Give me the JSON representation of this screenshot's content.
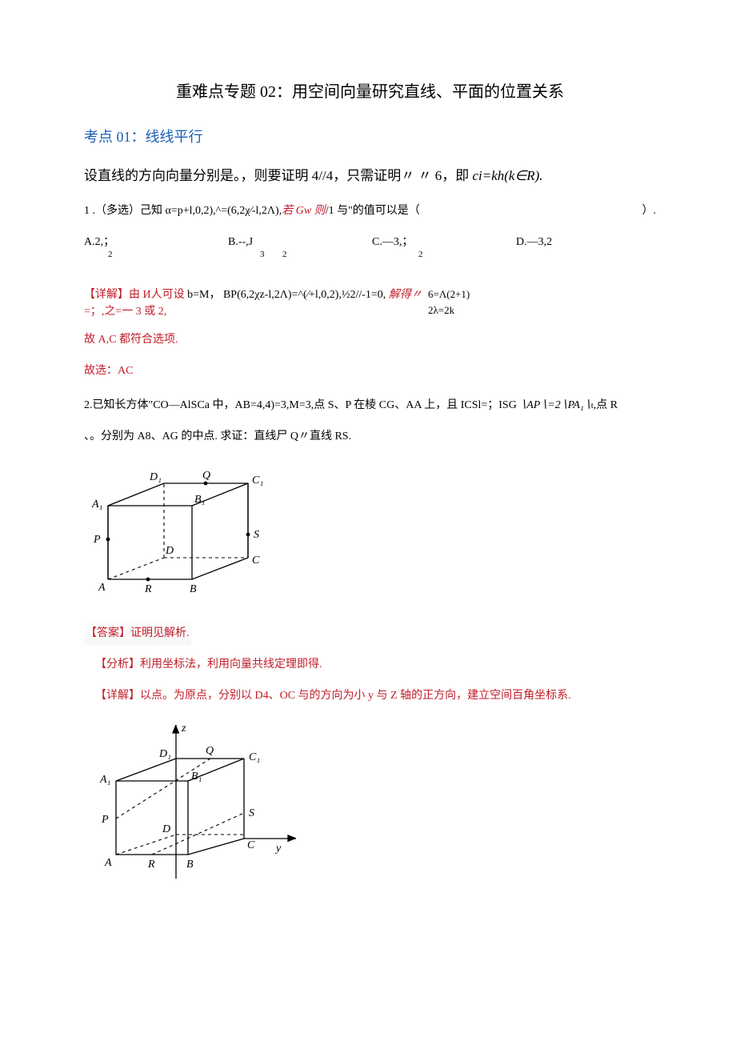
{
  "title": "重难点专题 02：用空间向量研究直线、平面的位置关系",
  "kaodian": "考点 01：线线平行",
  "intro": "设直线的方向向量分别是。，则要证明 4//4，只需证明〃 〃 6，即 ",
  "intro_formula": "ci=kh(k∈R).",
  "q1": "1 .（多选）己知 α=p+l,0,2),^=(6,2χ∕-l,2Λ),",
  "q1_ruo": "若 Gw 则",
  "q1_tail": "/1 与\"的值可以是（",
  "q1_close": "）.",
  "optA_main": "A.2,；",
  "optA_sub": "2",
  "optB_main": "B.--,J",
  "optB_sub1": "3",
  "optB_sub2": "2",
  "optC_main": "C.—3,；",
  "optC_sub": "2",
  "optD_main": "D.—3,2",
  "jiexi_tag": "【详解】",
  "jiexi_body1": "由 И人可设 ",
  "jiexi_body2": "b=M，  BP(6,2χz-l,2Λ)=^(∕+l,0,2),½2//-1=0,",
  "jiexi_jie": " 解得〃",
  "jiexi_body3": "=；,之=一 3 或 2,",
  "jiexi_right1": "6=Λ(2+1)",
  "jiexi_right2": "2λ=2k",
  "gu1": "故 A,C 都符合选项.",
  "gu2": "故选：AC",
  "q2a": "2.已知长方体\"CO—AlSCa 中，AB=4,4)=3,M=3,点 S、P 在棱 CG、AA 上，且 ICSl=；ISG",
  "q2a_mid": " ∖AP∖=2∖PA₁∖",
  "q2a_tail": ",点 R",
  "q2b": "、。分别为 A8、AG 的中点. 求证：直线尸 Q〃直线 RS.",
  "ans_tag": "【答案】",
  "ans_body": "证明见解析.",
  "fx_tag": "【分析】",
  "fx_body": "利用坐标法，利用向量共线定理即得.",
  "xj_tag": "【详解】",
  "xj_body": "以点。为原点，分别以 D4、OC 与的方向为小 y 与 Z 轴的正方向，建立空间百角坐标系.",
  "labels": {
    "A": "A",
    "B": "B",
    "C": "C",
    "D": "D",
    "A1": "A₁",
    "B1": "B₁",
    "C1": "C₁",
    "D1": "D₁",
    "P": "P",
    "Q": "Q",
    "R": "R",
    "S": "S",
    "y": "y",
    "z": "z"
  }
}
